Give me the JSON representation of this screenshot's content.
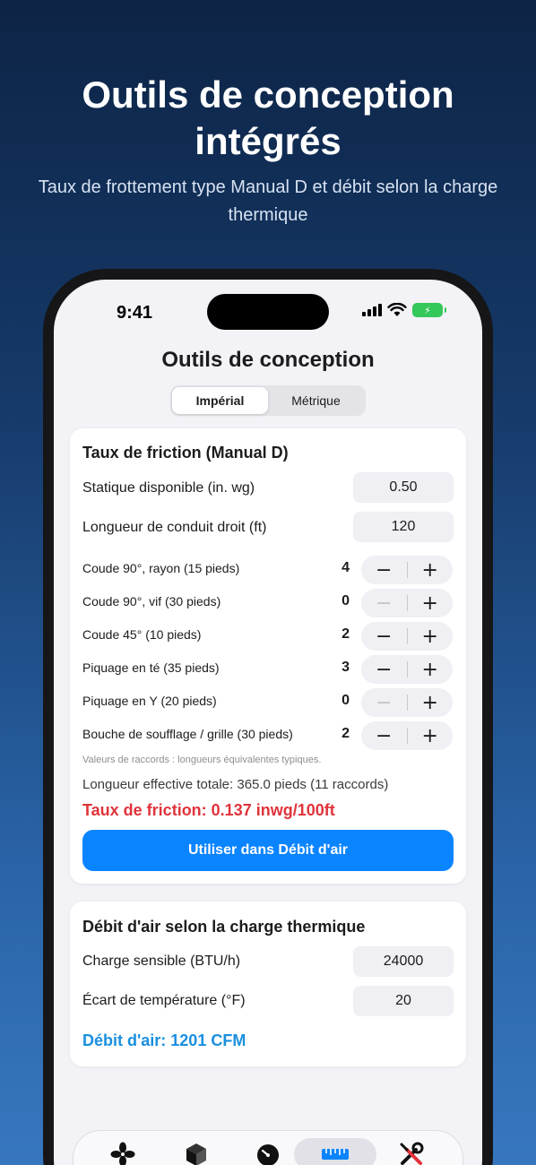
{
  "hero": {
    "title_line1": "Outils de conception",
    "title_line2": "intégrés",
    "subtitle": "Taux de frottement type Manual D et débit selon la charge thermique"
  },
  "status_bar": {
    "time": "9:41"
  },
  "page": {
    "title": "Outils de conception",
    "units": {
      "imperial": "Impérial",
      "metric": "Métrique",
      "selected": "Impérial"
    }
  },
  "friction": {
    "title": "Taux de friction (Manual D)",
    "static_label": "Statique disponible (in. wg)",
    "static_value": "0.50",
    "length_label": "Longueur de conduit droit (ft)",
    "length_value": "120",
    "fittings": [
      {
        "label": "Coude 90°, rayon  (15 pieds)",
        "count": "4"
      },
      {
        "label": "Coude 90°, vif  (30 pieds)",
        "count": "0"
      },
      {
        "label": "Coude 45°  (10 pieds)",
        "count": "2"
      },
      {
        "label": "Piquage en té  (35 pieds)",
        "count": "3"
      },
      {
        "label": "Piquage en Y  (20 pieds)",
        "count": "0"
      },
      {
        "label": "Bouche de soufflage / grille  (30 pieds)",
        "count": "2"
      }
    ],
    "note": "Valeurs de raccords : longueurs équivalentes typiques.",
    "effective_length": "Longueur effective totale: 365.0 pieds  (11 raccords)",
    "result": "Taux de friction: 0.137 inwg/100ft",
    "use_button": "Utiliser dans Débit d'air"
  },
  "airflow": {
    "title": "Débit d'air selon la charge thermique",
    "sensible_label": "Charge sensible (BTU/h)",
    "sensible_value": "24000",
    "delta_label": "Écart de température (°F)",
    "delta_value": "20",
    "result": "Débit d'air: 1201 CFM"
  },
  "stepper": {
    "minus": "−",
    "plus": "+"
  },
  "colors": {
    "accent": "#0a84ff",
    "friction_result": "#e0333b",
    "airflow_result": "#1a8fe0",
    "battery": "#34c759"
  },
  "tabs": [
    {
      "icon": "fan-icon"
    },
    {
      "icon": "cube-icon"
    },
    {
      "icon": "gauge-icon"
    },
    {
      "icon": "ruler-icon",
      "selected": true
    },
    {
      "icon": "tools-icon"
    }
  ]
}
